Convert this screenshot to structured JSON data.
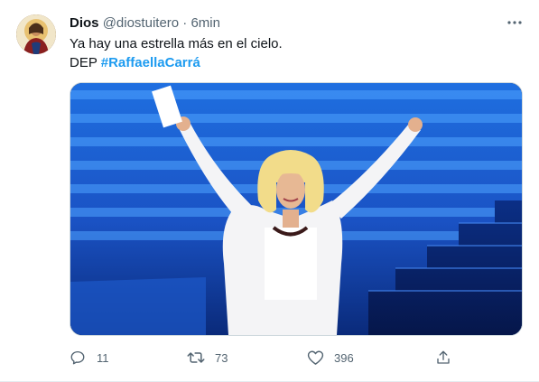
{
  "tweet": {
    "author": {
      "name": "Dios",
      "handle": "@diostuitero",
      "separator": "·",
      "time": "6min"
    },
    "text_line1": "Ya hay una estrella más en el cielo.",
    "text_line2_prefix": "DEP ",
    "hashtag": "#RaffaellaCarrá",
    "media": {
      "icon": "photo"
    },
    "actions": {
      "reply_count": "11",
      "retweet_count": "73",
      "like_count": "396"
    },
    "colors": {
      "accent": "#1d9bf0",
      "secondary_text": "#536471",
      "text": "#0f1419"
    }
  }
}
